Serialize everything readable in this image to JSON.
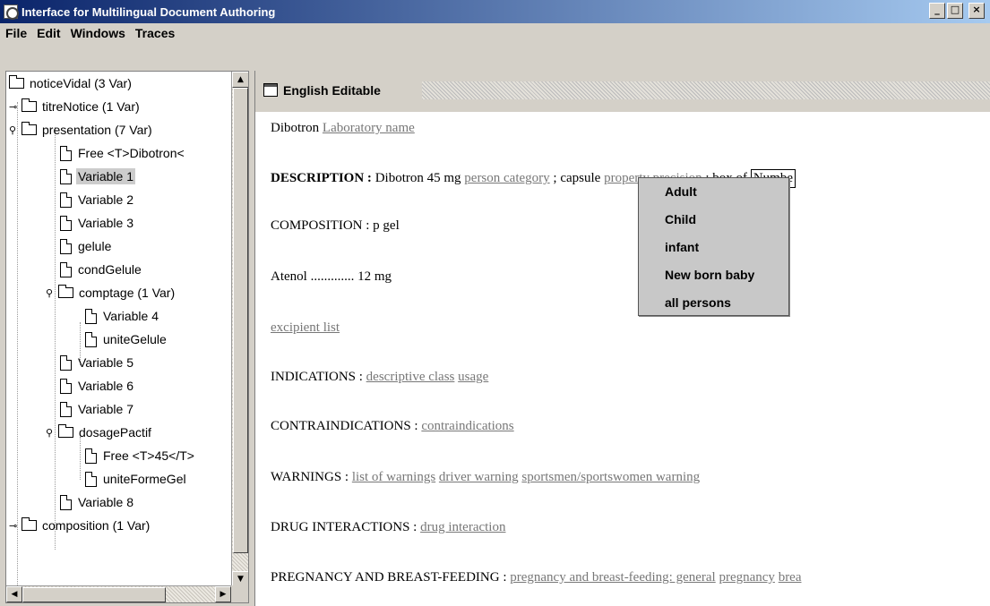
{
  "window": {
    "title": "Interface for Multilingual Document Authoring",
    "controls": [
      "_",
      "□",
      "×"
    ]
  },
  "menu": [
    "File",
    "Edit",
    "Windows",
    "Traces"
  ],
  "tree": {
    "nodes": [
      {
        "label": "noticeVidal (3 Var)",
        "icon": "folder-icon",
        "toggle": ""
      },
      {
        "label": "titreNotice (1 Var)",
        "icon": "folder-icon",
        "toggle": "collapsed"
      },
      {
        "label": "presentation (7 Var)",
        "icon": "folder-icon",
        "toggle": "expanded"
      },
      {
        "label": "Free <T>Dibotron<",
        "icon": "file-icon",
        "toggle": ""
      },
      {
        "label": "Variable 1",
        "icon": "file-icon",
        "toggle": "",
        "selected": true
      },
      {
        "label": "Variable 2",
        "icon": "file-icon",
        "toggle": ""
      },
      {
        "label": "Variable 3",
        "icon": "file-icon",
        "toggle": ""
      },
      {
        "label": "gelule",
        "icon": "file-icon",
        "toggle": ""
      },
      {
        "label": "condGelule",
        "icon": "file-icon",
        "toggle": ""
      },
      {
        "label": "comptage (1 Var)",
        "icon": "folder-icon",
        "toggle": "expanded"
      },
      {
        "label": "Variable 4",
        "icon": "file-icon",
        "toggle": ""
      },
      {
        "label": "uniteGelule",
        "icon": "file-icon",
        "toggle": ""
      },
      {
        "label": "Variable 5",
        "icon": "file-icon",
        "toggle": ""
      },
      {
        "label": "Variable 6",
        "icon": "file-icon",
        "toggle": ""
      },
      {
        "label": "Variable 7",
        "icon": "file-icon",
        "toggle": ""
      },
      {
        "label": "dosagePactif",
        "icon": "folder-icon",
        "toggle": "expanded"
      },
      {
        "label": "Free <T>45</T>",
        "icon": "file-icon",
        "toggle": ""
      },
      {
        "label": "uniteFormeGel",
        "icon": "file-icon",
        "toggle": ""
      },
      {
        "label": "Variable 8",
        "icon": "file-icon",
        "toggle": ""
      },
      {
        "label": "composition (1 Var)",
        "icon": "folder-icon",
        "toggle": "collapsed"
      }
    ]
  },
  "editor": {
    "title": "English Editable",
    "lines": {
      "l1": {
        "text": "Dibotron ",
        "link": "Laboratory name"
      },
      "l2": {
        "bold": "DESCRIPTION : ",
        "text1": "Dibotron 45 mg ",
        "link1": "person category",
        "text2": " ;  capsule ",
        "link2": "property precision",
        "text3": " ; box of ",
        "field": "Numbe"
      },
      "l3": {
        "text": "COMPOSITION : p   gel"
      },
      "l4": {
        "text": "Atenol ............. 12 mg"
      },
      "l5": {
        "link": "excipient list"
      },
      "l6": {
        "text": "INDICATIONS :  ",
        "link1": "descriptive class",
        "link2": "usage"
      },
      "l7": {
        "text": "CONTRAINDICATIONS : ",
        "link": "contraindications"
      },
      "l8": {
        "text": "WARNINGS : ",
        "link1": "list of warnings",
        "link2": "driver warning",
        "link3": "sportsmen/sportswomen warning"
      },
      "l9": {
        "text": "DRUG INTERACTIONS : ",
        "link": "drug interaction"
      },
      "l10": {
        "text": "PREGNANCY AND BREAST-FEEDING : ",
        "link1": "pregnancy and breast-feeding: general",
        "link2": "pregnancy",
        "link3": "brea"
      }
    }
  },
  "popup": {
    "items": [
      "Adult",
      "Child",
      "infant",
      "New born baby",
      "all persons"
    ]
  }
}
